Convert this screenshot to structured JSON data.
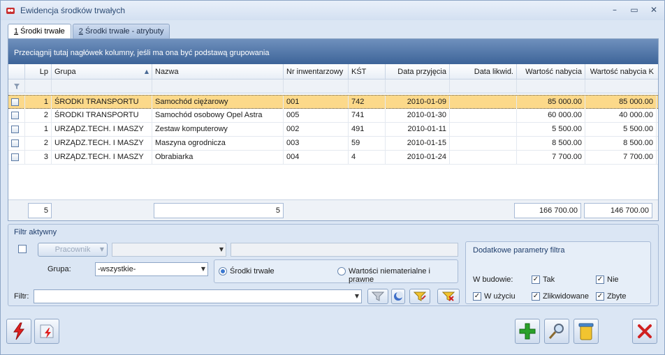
{
  "window": {
    "title": "Ewidencja środków trwałych"
  },
  "tabs": [
    {
      "num": "1",
      "label": " Środki trwałe"
    },
    {
      "num": "2",
      "label": " Środki trwałe - atrybuty"
    }
  ],
  "grid": {
    "group_hint": "Przeciągnij tutaj nagłówek kolumny, jeśli ma ona być podstawą grupowania",
    "columns": [
      "Lp",
      "Grupa",
      "Nazwa",
      "Nr inwentarzowy",
      "KŚT",
      "Data przyjęcia",
      "Data likwid.",
      "Wartość nabycia",
      "Wartość nabycia K"
    ],
    "sort_column": "Grupa",
    "rows": [
      {
        "lp": "1",
        "grupa": "ŚRODKI TRANSPORTU",
        "nazwa": "Samochód ciężarowy",
        "nr": "001",
        "kst": "742",
        "data_p": "2010-01-09",
        "data_l": "",
        "wn": "85 000.00",
        "wnk": "85 000.00"
      },
      {
        "lp": "2",
        "grupa": "ŚRODKI TRANSPORTU",
        "nazwa": "Samochód osobowy Opel Astra",
        "nr": "005",
        "kst": "741",
        "data_p": "2010-01-30",
        "data_l": "",
        "wn": "60 000.00",
        "wnk": "40 000.00"
      },
      {
        "lp": "1",
        "grupa": "URZĄDZ.TECH. I MASZY",
        "nazwa": "Zestaw komputerowy",
        "nr": "002",
        "kst": "491",
        "data_p": "2010-01-11",
        "data_l": "",
        "wn": "5 500.00",
        "wnk": "5 500.00"
      },
      {
        "lp": "2",
        "grupa": "URZĄDZ.TECH. I MASZY",
        "nazwa": "Maszyna ogrodnicza",
        "nr": "003",
        "kst": "59",
        "data_p": "2010-01-15",
        "data_l": "",
        "wn": "8 500.00",
        "wnk": "8 500.00"
      },
      {
        "lp": "3",
        "grupa": "URZĄDZ.TECH. I MASZY",
        "nazwa": "Obrabiarka",
        "nr": "004",
        "kst": "4",
        "data_p": "2010-01-24",
        "data_l": "",
        "wn": "7 700.00",
        "wnk": "7 700.00"
      }
    ],
    "footer": {
      "count_lp": "5",
      "count_nazwa": "5",
      "sum_wn": "166 700.00",
      "sum_wnk": "146 700.00"
    }
  },
  "filter": {
    "title": "Filtr aktywny",
    "pracownik_label": "Pracownik",
    "grupa_label": "Grupa:",
    "grupa_value": "-wszystkie-",
    "radio_st": "Środki trwałe",
    "radio_wnip": "Wartości niematerialne i prawne",
    "filtr_label": "Filtr:",
    "filtr_value": ""
  },
  "extra": {
    "title": "Dodatkowe parametry filtra",
    "w_budowie": "W budowie:",
    "tak": "Tak",
    "nie": "Nie",
    "w_uzyciu": "W użyciu",
    "zlikwidowane": "Zlikwidowane",
    "zbyte": "Zbyte",
    "check_mark": "✓"
  },
  "colors": {
    "selected_row": "#fcd98a",
    "group_bar": "#4f74a8",
    "add": "#2aa12a",
    "close": "#d02020"
  }
}
